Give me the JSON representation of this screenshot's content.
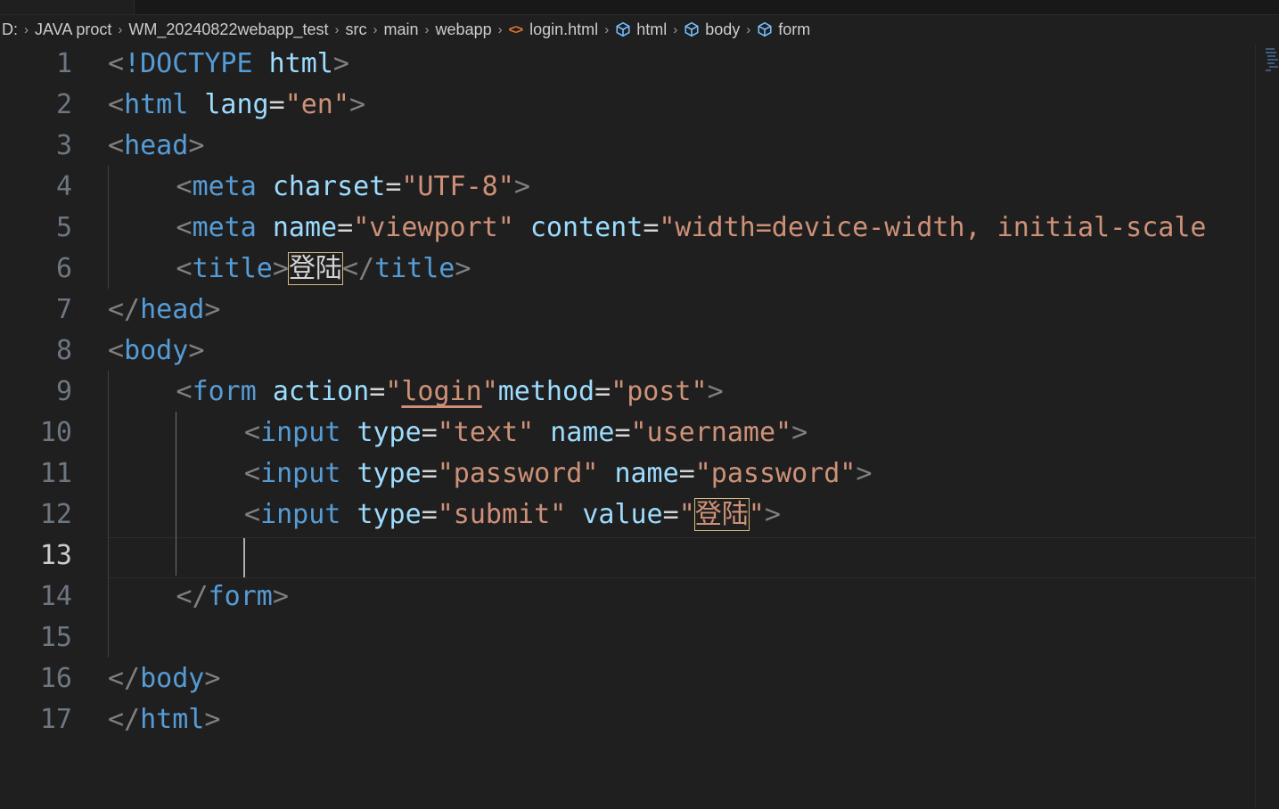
{
  "breadcrumb": [
    {
      "label": "D:",
      "kind": "folder"
    },
    {
      "label": "JAVA proct",
      "kind": "folder"
    },
    {
      "label": "WM_20240822webapp_test",
      "kind": "folder"
    },
    {
      "label": "src",
      "kind": "folder"
    },
    {
      "label": "main",
      "kind": "folder"
    },
    {
      "label": "webapp",
      "kind": "folder"
    },
    {
      "label": "login.html",
      "kind": "file",
      "icon": "html-file-icon",
      "icon_glyph": "<>",
      "icon_color": "#e37933"
    },
    {
      "label": "html",
      "kind": "symbol",
      "icon": "symbol-element-icon"
    },
    {
      "label": "body",
      "kind": "symbol",
      "icon": "symbol-element-icon"
    },
    {
      "label": "form",
      "kind": "symbol",
      "icon": "symbol-element-icon"
    }
  ],
  "editor": {
    "active_line": 13,
    "lines": [
      {
        "n": 1,
        "indent": 0,
        "tokens": [
          [
            "p",
            "<"
          ],
          [
            "t",
            "!DOCTYPE"
          ],
          [
            "e",
            " "
          ],
          [
            "a",
            "html"
          ],
          [
            "p",
            ">"
          ]
        ]
      },
      {
        "n": 2,
        "indent": 0,
        "tokens": [
          [
            "p",
            "<"
          ],
          [
            "t",
            "html"
          ],
          [
            "e",
            " "
          ],
          [
            "a",
            "lang"
          ],
          [
            "e",
            "="
          ],
          [
            "s",
            "\"en\""
          ],
          [
            "p",
            ">"
          ]
        ]
      },
      {
        "n": 3,
        "indent": 0,
        "tokens": [
          [
            "p",
            "<"
          ],
          [
            "t",
            "head"
          ],
          [
            "p",
            ">"
          ]
        ]
      },
      {
        "n": 4,
        "indent": 1,
        "tokens": [
          [
            "p",
            "<"
          ],
          [
            "t",
            "meta"
          ],
          [
            "e",
            " "
          ],
          [
            "a",
            "charset"
          ],
          [
            "e",
            "="
          ],
          [
            "s",
            "\"UTF-8\""
          ],
          [
            "p",
            ">"
          ]
        ]
      },
      {
        "n": 5,
        "indent": 1,
        "tokens": [
          [
            "p",
            "<"
          ],
          [
            "t",
            "meta"
          ],
          [
            "e",
            " "
          ],
          [
            "a",
            "name"
          ],
          [
            "e",
            "="
          ],
          [
            "s",
            "\"viewport\""
          ],
          [
            "e",
            " "
          ],
          [
            "a",
            "content"
          ],
          [
            "e",
            "="
          ],
          [
            "s",
            "\"width=device-width, initial-scale"
          ]
        ]
      },
      {
        "n": 6,
        "indent": 1,
        "tokens": [
          [
            "p",
            "<"
          ],
          [
            "t",
            "title"
          ],
          [
            "p",
            ">"
          ],
          [
            "hl",
            "登陆"
          ],
          [
            "p",
            "</"
          ],
          [
            "t",
            "title"
          ],
          [
            "p",
            ">"
          ]
        ]
      },
      {
        "n": 7,
        "indent": 0,
        "tokens": [
          [
            "p",
            "</"
          ],
          [
            "t",
            "head"
          ],
          [
            "p",
            ">"
          ]
        ]
      },
      {
        "n": 8,
        "indent": 0,
        "tokens": [
          [
            "p",
            "<"
          ],
          [
            "t",
            "body"
          ],
          [
            "p",
            ">"
          ]
        ]
      },
      {
        "n": 9,
        "indent": 1,
        "tokens": [
          [
            "p",
            "<"
          ],
          [
            "t",
            "form"
          ],
          [
            "e",
            " "
          ],
          [
            "a",
            "action"
          ],
          [
            "e",
            "="
          ],
          [
            "s",
            "\""
          ],
          [
            "su",
            "login"
          ],
          [
            "s",
            "\""
          ],
          [
            "a",
            "method"
          ],
          [
            "e",
            "="
          ],
          [
            "s",
            "\"post\""
          ],
          [
            "p",
            ">"
          ]
        ]
      },
      {
        "n": 10,
        "indent": 2,
        "tokens": [
          [
            "p",
            "<"
          ],
          [
            "t",
            "input"
          ],
          [
            "e",
            " "
          ],
          [
            "a",
            "type"
          ],
          [
            "e",
            "="
          ],
          [
            "s",
            "\"text\""
          ],
          [
            "e",
            " "
          ],
          [
            "a",
            "name"
          ],
          [
            "e",
            "="
          ],
          [
            "s",
            "\"username\""
          ],
          [
            "p",
            ">"
          ]
        ]
      },
      {
        "n": 11,
        "indent": 2,
        "tokens": [
          [
            "p",
            "<"
          ],
          [
            "t",
            "input"
          ],
          [
            "e",
            " "
          ],
          [
            "a",
            "type"
          ],
          [
            "e",
            "="
          ],
          [
            "s",
            "\"password\""
          ],
          [
            "e",
            " "
          ],
          [
            "a",
            "name"
          ],
          [
            "e",
            "="
          ],
          [
            "s",
            "\"password\""
          ],
          [
            "p",
            ">"
          ]
        ]
      },
      {
        "n": 12,
        "indent": 2,
        "tokens": [
          [
            "p",
            "<"
          ],
          [
            "t",
            "input"
          ],
          [
            "e",
            " "
          ],
          [
            "a",
            "type"
          ],
          [
            "e",
            "="
          ],
          [
            "s",
            "\"submit\""
          ],
          [
            "e",
            " "
          ],
          [
            "a",
            "value"
          ],
          [
            "e",
            "="
          ],
          [
            "s",
            "\""
          ],
          [
            "hls",
            "登陆"
          ],
          [
            "s",
            "\""
          ],
          [
            "p",
            ">"
          ]
        ]
      },
      {
        "n": 13,
        "indent": 2,
        "tokens": []
      },
      {
        "n": 14,
        "indent": 1,
        "tokens": [
          [
            "p",
            "</"
          ],
          [
            "t",
            "form"
          ],
          [
            "p",
            ">"
          ]
        ]
      },
      {
        "n": 15,
        "indent": 1,
        "tokens": []
      },
      {
        "n": 16,
        "indent": 0,
        "tokens": [
          [
            "p",
            "</"
          ],
          [
            "t",
            "body"
          ],
          [
            "p",
            ">"
          ]
        ]
      },
      {
        "n": 17,
        "indent": 0,
        "tokens": [
          [
            "p",
            "</"
          ],
          [
            "t",
            "html"
          ],
          [
            "p",
            ">"
          ]
        ]
      }
    ]
  },
  "colors": {
    "background": "#1f1f1f",
    "punctuation": "#808080",
    "tag": "#569cd6",
    "attribute": "#9cdcfe",
    "string": "#ce9178",
    "highlight_border": "#d7ba7d"
  }
}
